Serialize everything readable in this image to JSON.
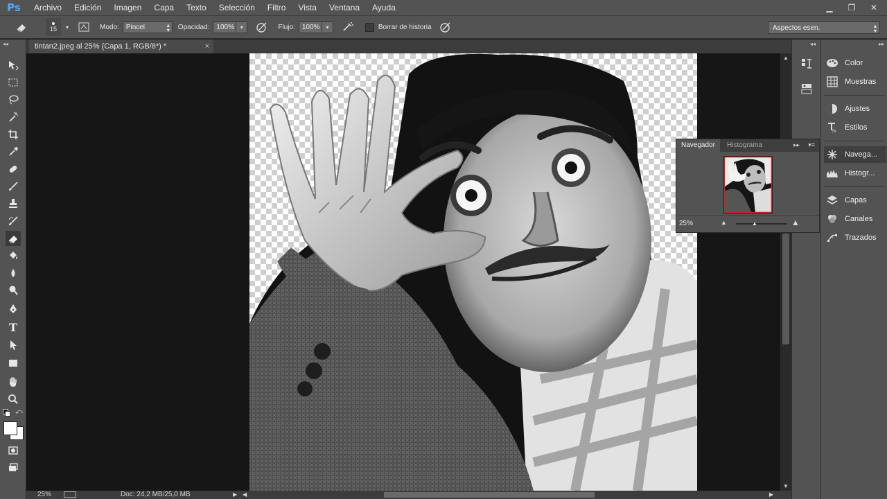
{
  "app": {
    "logo": "Ps"
  },
  "menu": [
    "Archivo",
    "Edición",
    "Imagen",
    "Capa",
    "Texto",
    "Selección",
    "Filtro",
    "Vista",
    "Ventana",
    "Ayuda"
  ],
  "options": {
    "brush_size": "15",
    "mode_label": "Modo:",
    "mode_value": "Pincel",
    "opacity_label": "Opacidad:",
    "opacity_value": "100%",
    "flow_label": "Flujo:",
    "flow_value": "100%",
    "history_label": "Borrar de historia",
    "workspace": "Aspectos esen."
  },
  "document": {
    "tab_title": "tintan2.jpeg al 25% (Capa 1, RGB/8*) *",
    "close": "×"
  },
  "status": {
    "zoom": "25%",
    "doc": "Doc: 24,2 MB/25,0 MB"
  },
  "navigator": {
    "tabs": [
      "Navegador",
      "Histograma"
    ],
    "zoom": "25%"
  },
  "dock": {
    "groups": [
      [
        {
          "label": "Color",
          "icon": "palette-icon"
        },
        {
          "label": "Muestras",
          "icon": "swatches-icon"
        }
      ],
      [
        {
          "label": "Ajustes",
          "icon": "adjustments-icon"
        },
        {
          "label": "Estilos",
          "icon": "styles-icon"
        }
      ],
      [
        {
          "label": "Navega...",
          "icon": "navigator-icon"
        },
        {
          "label": "Histogr...",
          "icon": "histogram-icon"
        }
      ],
      [
        {
          "label": "Capas",
          "icon": "layers-icon"
        },
        {
          "label": "Canales",
          "icon": "channels-icon"
        },
        {
          "label": "Trazados",
          "icon": "paths-icon"
        }
      ]
    ]
  },
  "colors": {
    "chrome": "#535353",
    "canvas_bg": "#161616",
    "accent": "#4da8ff"
  }
}
